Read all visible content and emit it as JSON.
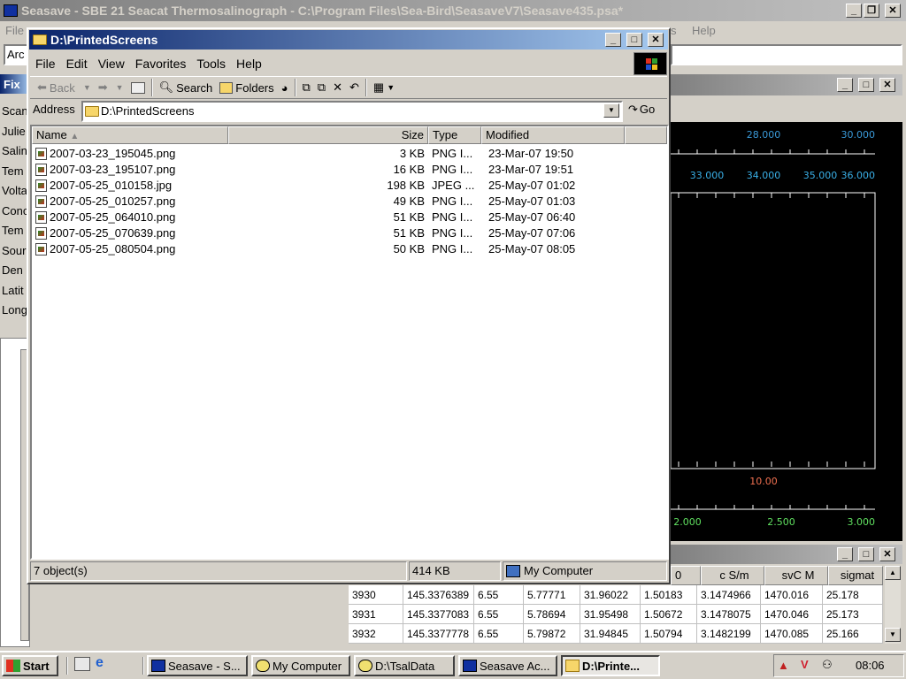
{
  "seasave": {
    "title": "Seasave - SBE 21 Seacat Thermosalinograph - C:\\Program Files\\Sea-Bird\\SeasaveV7\\Seasave435.psa*",
    "menu": [
      "File",
      "Help"
    ],
    "menu_partial": "s",
    "address_partial": "Arc",
    "fixed_title": "Fix",
    "fixed_labels": [
      "Scan",
      "Julie",
      "Salin",
      "Tem",
      "Volta",
      "Conc",
      "Tem",
      "Sour",
      "Den",
      "Latit",
      "Long"
    ]
  },
  "plot": {
    "axes": [
      {
        "ticks": [
          "28.000",
          "30.000"
        ],
        "color": "#3a9ad9"
      },
      {
        "ticks": [
          "33.000",
          "34.000",
          "35.000",
          "36.000"
        ],
        "color": "#3ab0e8"
      },
      {
        "ticks": [
          "10.00"
        ],
        "color": "#f07050"
      },
      {
        "ticks": [
          "2.000",
          "2.500",
          "3.000"
        ],
        "color": "#60e060"
      }
    ]
  },
  "grid": {
    "columns": [
      "0",
      "c S/m",
      "svC M",
      "sigmat"
    ],
    "rows": [
      [
        "3930",
        "145.3376389",
        "6.55",
        "5.77771",
        "31.96022",
        "1.50183",
        "3.1474966",
        "1470.016",
        "25.178"
      ],
      [
        "3931",
        "145.3377083",
        "6.55",
        "5.78694",
        "31.95498",
        "1.50672",
        "3.1478075",
        "1470.046",
        "25.173"
      ],
      [
        "3932",
        "145.3377778",
        "6.55",
        "5.79872",
        "31.94845",
        "1.50794",
        "3.1482199",
        "1470.085",
        "25.166"
      ]
    ]
  },
  "explorer": {
    "title": "D:\\PrintedScreens",
    "menu": [
      "File",
      "Edit",
      "View",
      "Favorites",
      "Tools",
      "Help"
    ],
    "toolbar": {
      "back": "Back",
      "search": "Search",
      "folders": "Folders"
    },
    "address_label": "Address",
    "address_value": "D:\\PrintedScreens",
    "go_label": "Go",
    "columns": {
      "name": "Name",
      "size": "Size",
      "type": "Type",
      "modified": "Modified"
    },
    "files": [
      {
        "name": "2007-03-23_195045.png",
        "size": "3 KB",
        "type": "PNG I...",
        "modified": "23-Mar-07 19:50"
      },
      {
        "name": "2007-03-23_195107.png",
        "size": "16 KB",
        "type": "PNG I...",
        "modified": "23-Mar-07 19:51"
      },
      {
        "name": "2007-05-25_010158.jpg",
        "size": "198 KB",
        "type": "JPEG ...",
        "modified": "25-May-07 01:02"
      },
      {
        "name": "2007-05-25_010257.png",
        "size": "49 KB",
        "type": "PNG I...",
        "modified": "25-May-07 01:03"
      },
      {
        "name": "2007-05-25_064010.png",
        "size": "51 KB",
        "type": "PNG I...",
        "modified": "25-May-07 06:40"
      },
      {
        "name": "2007-05-25_070639.png",
        "size": "51 KB",
        "type": "PNG I...",
        "modified": "25-May-07 07:06"
      },
      {
        "name": "2007-05-25_080504.png",
        "size": "50 KB",
        "type": "PNG I...",
        "modified": "25-May-07 08:05"
      }
    ],
    "status": {
      "count": "7 object(s)",
      "size": "414 KB",
      "zone": "My Computer"
    }
  },
  "taskbar": {
    "start": "Start",
    "tasks": [
      {
        "label": "Seasave - S...",
        "icon": "seasave-icon"
      },
      {
        "label": "My Computer",
        "icon": "search-icon"
      },
      {
        "label": "D:\\TsalData",
        "icon": "search-icon"
      },
      {
        "label": "Seasave Ac...",
        "icon": "seasave-icon"
      },
      {
        "label": "D:\\Printe...",
        "icon": "folder-icon"
      }
    ],
    "clock": "08:06"
  }
}
